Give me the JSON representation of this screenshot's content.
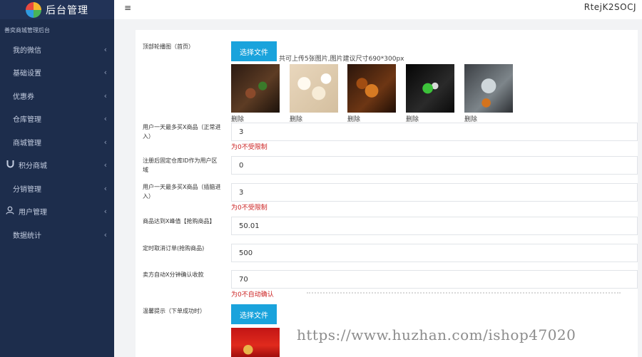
{
  "brand": {
    "title": "后台管理"
  },
  "sidebar": {
    "subtitle": "善奕商城管理后台",
    "items": [
      {
        "label": "我的微信",
        "icon": ""
      },
      {
        "label": "基础设置",
        "icon": ""
      },
      {
        "label": "优惠券",
        "icon": ""
      },
      {
        "label": "仓库管理",
        "icon": ""
      },
      {
        "label": "商城管理",
        "icon": ""
      },
      {
        "label": "积分商城",
        "icon": "magnet-icon"
      },
      {
        "label": "分销管理",
        "icon": ""
      },
      {
        "label": "用户管理",
        "icon": "user-icon"
      },
      {
        "label": "数据统计",
        "icon": ""
      }
    ],
    "chevron": "‹"
  },
  "topbar": {
    "menu_glyph": "≡",
    "username": "RtejK2SOCJ"
  },
  "form": {
    "carousel": {
      "label": "顶部轮播图（首页）",
      "button": "选择文件",
      "hint": "共可上传5张图片,图片建议尺寸690*300px",
      "delete_label": "删除",
      "images": [
        "img1",
        "img2",
        "img3",
        "img4",
        "img5"
      ]
    },
    "fields": [
      {
        "label": "用户一天最多买X商品（正常进入）",
        "value": "3",
        "note": "为0不受限制"
      },
      {
        "label": "注册后固定仓库ID作为用户区域",
        "value": "0",
        "note": ""
      },
      {
        "label": "用户一天最多买X商品（插脑进入）",
        "value": "3",
        "note": "为0不受限制"
      },
      {
        "label": "商品达到X峰值【抢购商品】",
        "value": "50.01",
        "note": ""
      },
      {
        "label": "定时取消订单(抢购商品)",
        "value": "500",
        "note": ""
      },
      {
        "label": "卖方自动X分钟确认收款",
        "value": "70",
        "note": "为0不自动确认"
      }
    ],
    "success_tip": {
      "label": "温馨提示（下单成功时）",
      "button": "选择文件"
    }
  },
  "watermark": "https://www.huzhan.com/ishop47020"
}
